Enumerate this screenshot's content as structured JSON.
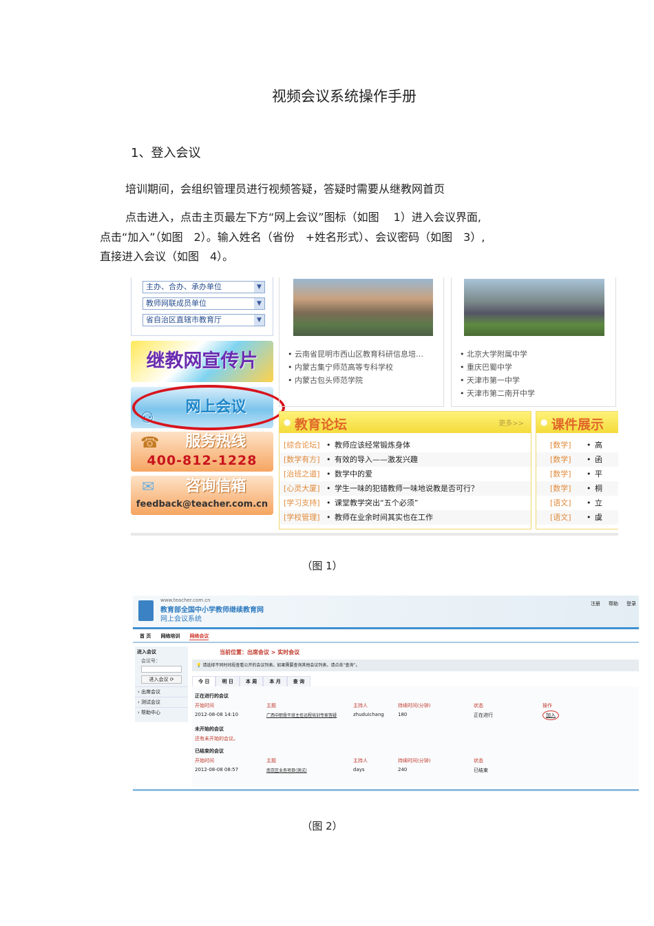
{
  "doc": {
    "title": "视频会议系统操作手册",
    "section": "1、登入会议",
    "paragraphs": [
      "培训期间，会组织管理员进行视频答疑，答疑时需要从继教网首页",
      "点击进入，点击主页最左下方“网上会议”图标（如图　 1）进入会议界面,",
      "点击“加入”（如图　2）。输入姓名（省份　+姓名形式）、会议密码（如图　3）,",
      "直接进入会议（如图　4）。"
    ],
    "captions": [
      "（图 1）",
      "（图 2）"
    ]
  },
  "fig1": {
    "dropdowns": [
      "主办、合办、承办单位",
      "教师网联成员单位",
      "省自治区直辖市教育厅"
    ],
    "promo": "继教网宣传片",
    "meeting": "网上会议",
    "hotline_label": "服务热线",
    "hotline": "400-812-1228",
    "mail_label": "咨询信箱",
    "mail": "feedback@teacher.com.cn",
    "list_mid": [
      "云南省昆明市西山区教育科研信息培…",
      "内蒙古集宁师范高等专科学校",
      "内蒙古包头师范学院"
    ],
    "list_right": [
      "北京大学附属中学",
      "重庆巴蜀中学",
      "天津市第一中学",
      "天津市第二南开中学"
    ],
    "forum": {
      "title": "教育论坛",
      "more": "更多>>",
      "rows": [
        {
          "cat": "[综合论坛]",
          "text": "教师应该经常锻炼身体"
        },
        {
          "cat": "[数学有方]",
          "text": "有效的导入——激发兴趣"
        },
        {
          "cat": "[治班之道]",
          "text": "数学中的爱"
        },
        {
          "cat": "[心灵大厦]",
          "text": "学生一味的犯错教师一味地说教是否可行？"
        },
        {
          "cat": "[学习支持]",
          "text": "课堂教学突出“五个必须”"
        },
        {
          "cat": "[学校管理]",
          "text": "教师在业余时间其实也在工作"
        }
      ]
    },
    "course": {
      "title": "课件展示",
      "rows": [
        {
          "cat": "[数学]",
          "text": "高"
        },
        {
          "cat": "[数学]",
          "text": "函"
        },
        {
          "cat": "[数学]",
          "text": "平"
        },
        {
          "cat": "[数学]",
          "text": "桐"
        },
        {
          "cat": "[语文]",
          "text": "立"
        },
        {
          "cat": "[语文]",
          "text": "虞"
        }
      ]
    }
  },
  "fig2": {
    "url": "www.teacher.com.cn",
    "site": "教育部全国中小学教师继续教育网",
    "system": "网上会议系统",
    "top_links": [
      "注册",
      "帮助",
      "登录"
    ],
    "nav": [
      "首 页",
      "网络培训",
      "网络会议"
    ],
    "sidebar": {
      "title": "进入会议",
      "field_label": "会议号：",
      "enter_button": "进入会议",
      "items": [
        "出席会议",
        "测试会议",
        "帮助中心"
      ]
    },
    "breadcrumb": "当前位置：出席会议 > 实时会议",
    "tip": "请选择不同时间段查看公开的会议列表。如果需要查询其他会议列表，请点击“查询”。",
    "tabs": [
      "今 日",
      "明 日",
      "本 周",
      "本 月",
      "查 询"
    ],
    "ongoing": {
      "title": "正在进行的会议",
      "headers": [
        "开始时间",
        "主题",
        "主持人",
        "持续时间(分钟)",
        "状态",
        "操作"
      ],
      "row": [
        "2012-08-08 14:10",
        "广西中职骨干班主任远程培训专家答疑",
        "zhuduichang",
        "180",
        "正在进行",
        "加入"
      ]
    },
    "upcoming": {
      "title": "未开始的会议",
      "empty": "还有未开始的会议。"
    },
    "ended": {
      "title": "已结束的会议",
      "headers": [
        "开始时间",
        "主题",
        "主持人",
        "持续时间(分钟)",
        "状态"
      ],
      "row": [
        "2012-08-08 08:57",
        "南京区业务项目(测试)",
        "days",
        "240",
        "已结束"
      ]
    }
  }
}
